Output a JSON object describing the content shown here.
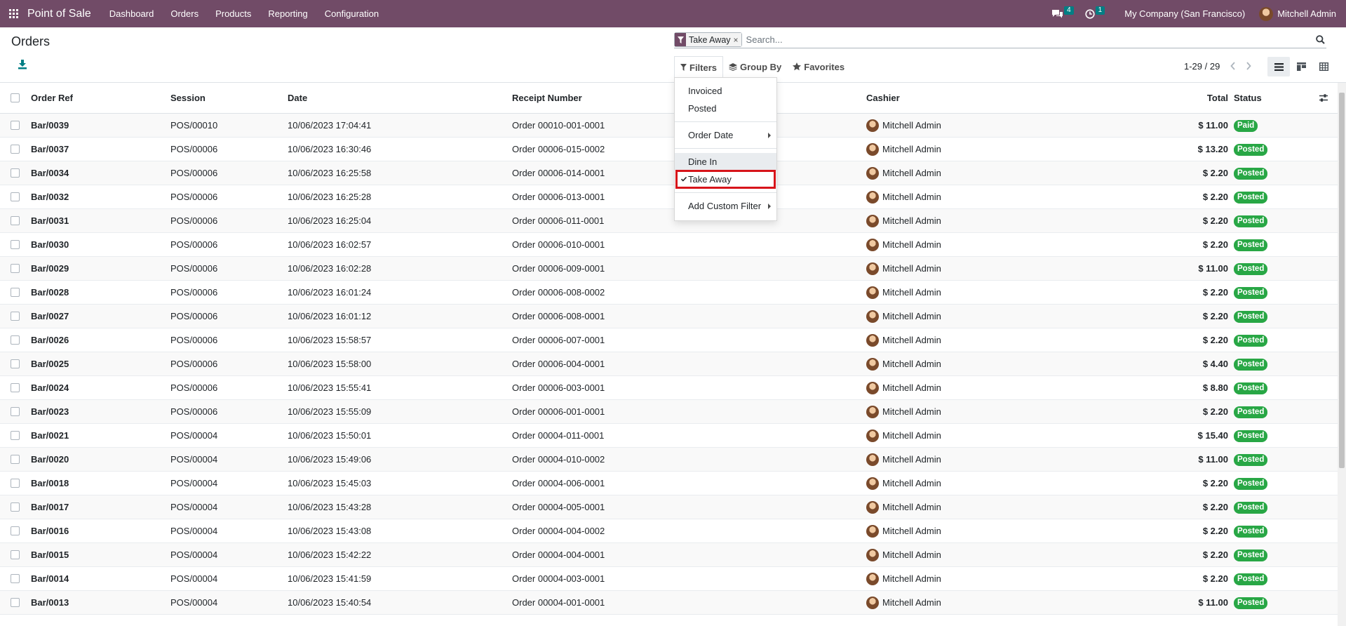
{
  "app": {
    "name": "Point of Sale"
  },
  "nav": {
    "menu": [
      "Dashboard",
      "Orders",
      "Products",
      "Reporting",
      "Configuration"
    ]
  },
  "systray": {
    "messages_count": "4",
    "activities_count": "1",
    "company": "My Company (San Francisco)",
    "user": "Mitchell Admin"
  },
  "page": {
    "title": "Orders"
  },
  "search": {
    "facet": "Take Away",
    "facet_remove": "×",
    "placeholder": "Search..."
  },
  "filters": {
    "filters_label": "Filters",
    "groupby_label": "Group By",
    "favorites_label": "Favorites"
  },
  "pager": {
    "value": "1-29 / 29"
  },
  "dropdown": {
    "invoiced": "Invoiced",
    "posted": "Posted",
    "order_date": "Order Date",
    "dine_in": "Dine In",
    "take_away": "Take Away",
    "add_custom": "Add Custom Filter"
  },
  "table": {
    "headers": {
      "order_ref": "Order Ref",
      "session": "Session",
      "date": "Date",
      "receipt": "Receipt Number",
      "cashier": "Cashier",
      "total": "Total",
      "status": "Status"
    },
    "rows": [
      {
        "ref": "Bar/0039",
        "session": "POS/00010",
        "date": "10/06/2023 17:04:41",
        "receipt": "Order 00010-001-0001",
        "cashier": "Mitchell Admin",
        "total": "$ 11.00",
        "status": "Paid"
      },
      {
        "ref": "Bar/0037",
        "session": "POS/00006",
        "date": "10/06/2023 16:30:46",
        "receipt": "Order 00006-015-0002",
        "cashier": "Mitchell Admin",
        "total": "$ 13.20",
        "status": "Posted"
      },
      {
        "ref": "Bar/0034",
        "session": "POS/00006",
        "date": "10/06/2023 16:25:58",
        "receipt": "Order 00006-014-0001",
        "cashier": "Mitchell Admin",
        "total": "$ 2.20",
        "status": "Posted"
      },
      {
        "ref": "Bar/0032",
        "session": "POS/00006",
        "date": "10/06/2023 16:25:28",
        "receipt": "Order 00006-013-0001",
        "cashier": "Mitchell Admin",
        "total": "$ 2.20",
        "status": "Posted"
      },
      {
        "ref": "Bar/0031",
        "session": "POS/00006",
        "date": "10/06/2023 16:25:04",
        "receipt": "Order 00006-011-0001",
        "cashier": "Mitchell Admin",
        "total": "$ 2.20",
        "status": "Posted"
      },
      {
        "ref": "Bar/0030",
        "session": "POS/00006",
        "date": "10/06/2023 16:02:57",
        "receipt": "Order 00006-010-0001",
        "cashier": "Mitchell Admin",
        "total": "$ 2.20",
        "status": "Posted"
      },
      {
        "ref": "Bar/0029",
        "session": "POS/00006",
        "date": "10/06/2023 16:02:28",
        "receipt": "Order 00006-009-0001",
        "cashier": "Mitchell Admin",
        "total": "$ 11.00",
        "status": "Posted"
      },
      {
        "ref": "Bar/0028",
        "session": "POS/00006",
        "date": "10/06/2023 16:01:24",
        "receipt": "Order 00006-008-0002",
        "cashier": "Mitchell Admin",
        "total": "$ 2.20",
        "status": "Posted"
      },
      {
        "ref": "Bar/0027",
        "session": "POS/00006",
        "date": "10/06/2023 16:01:12",
        "receipt": "Order 00006-008-0001",
        "cashier": "Mitchell Admin",
        "total": "$ 2.20",
        "status": "Posted"
      },
      {
        "ref": "Bar/0026",
        "session": "POS/00006",
        "date": "10/06/2023 15:58:57",
        "receipt": "Order 00006-007-0001",
        "cashier": "Mitchell Admin",
        "total": "$ 2.20",
        "status": "Posted"
      },
      {
        "ref": "Bar/0025",
        "session": "POS/00006",
        "date": "10/06/2023 15:58:00",
        "receipt": "Order 00006-004-0001",
        "cashier": "Mitchell Admin",
        "total": "$ 4.40",
        "status": "Posted"
      },
      {
        "ref": "Bar/0024",
        "session": "POS/00006",
        "date": "10/06/2023 15:55:41",
        "receipt": "Order 00006-003-0001",
        "cashier": "Mitchell Admin",
        "total": "$ 8.80",
        "status": "Posted"
      },
      {
        "ref": "Bar/0023",
        "session": "POS/00006",
        "date": "10/06/2023 15:55:09",
        "receipt": "Order 00006-001-0001",
        "cashier": "Mitchell Admin",
        "total": "$ 2.20",
        "status": "Posted"
      },
      {
        "ref": "Bar/0021",
        "session": "POS/00004",
        "date": "10/06/2023 15:50:01",
        "receipt": "Order 00004-011-0001",
        "cashier": "Mitchell Admin",
        "total": "$ 15.40",
        "status": "Posted"
      },
      {
        "ref": "Bar/0020",
        "session": "POS/00004",
        "date": "10/06/2023 15:49:06",
        "receipt": "Order 00004-010-0002",
        "cashier": "Mitchell Admin",
        "total": "$ 11.00",
        "status": "Posted"
      },
      {
        "ref": "Bar/0018",
        "session": "POS/00004",
        "date": "10/06/2023 15:45:03",
        "receipt": "Order 00004-006-0001",
        "cashier": "Mitchell Admin",
        "total": "$ 2.20",
        "status": "Posted"
      },
      {
        "ref": "Bar/0017",
        "session": "POS/00004",
        "date": "10/06/2023 15:43:28",
        "receipt": "Order 00004-005-0001",
        "cashier": "Mitchell Admin",
        "total": "$ 2.20",
        "status": "Posted"
      },
      {
        "ref": "Bar/0016",
        "session": "POS/00004",
        "date": "10/06/2023 15:43:08",
        "receipt": "Order 00004-004-0002",
        "cashier": "Mitchell Admin",
        "total": "$ 2.20",
        "status": "Posted"
      },
      {
        "ref": "Bar/0015",
        "session": "POS/00004",
        "date": "10/06/2023 15:42:22",
        "receipt": "Order 00004-004-0001",
        "cashier": "Mitchell Admin",
        "total": "$ 2.20",
        "status": "Posted"
      },
      {
        "ref": "Bar/0014",
        "session": "POS/00004",
        "date": "10/06/2023 15:41:59",
        "receipt": "Order 00004-003-0001",
        "cashier": "Mitchell Admin",
        "total": "$ 2.20",
        "status": "Posted"
      },
      {
        "ref": "Bar/0013",
        "session": "POS/00004",
        "date": "10/06/2023 15:40:54",
        "receipt": "Order 00004-001-0001",
        "cashier": "Mitchell Admin",
        "total": "$ 11.00",
        "status": "Posted"
      }
    ]
  }
}
